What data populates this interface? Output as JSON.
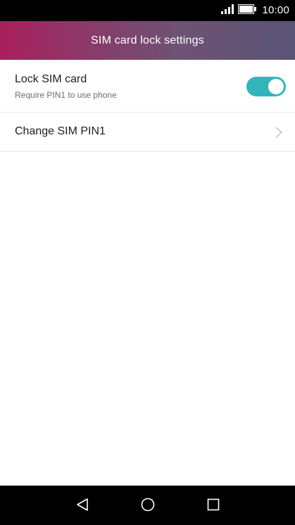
{
  "status_bar": {
    "time": "10:00",
    "signal_icon": "signal-icon",
    "battery_icon": "battery-icon"
  },
  "header": {
    "title": "SIM card lock settings"
  },
  "settings": {
    "lock_sim": {
      "title": "Lock SIM card",
      "subtitle": "Require PIN1 to use phone",
      "enabled": true
    },
    "change_pin": {
      "title": "Change SIM PIN1",
      "icon": "chevron-right-icon"
    }
  },
  "nav_bar": {
    "back_icon": "back-triangle-icon",
    "home_icon": "home-circle-icon",
    "recent_icon": "recent-square-icon"
  },
  "colors": {
    "toggle_on": "#33b5bd",
    "header_gradient_start": "#a9205c",
    "header_gradient_end": "#5a5476"
  }
}
